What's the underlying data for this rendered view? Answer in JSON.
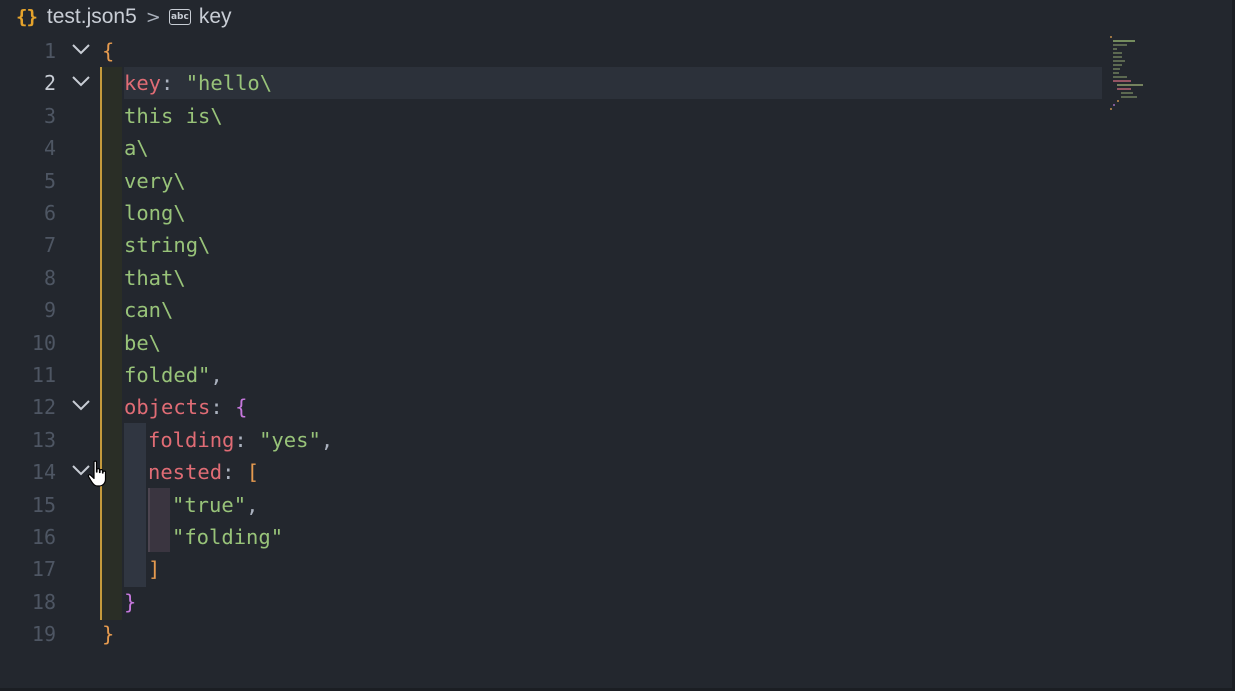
{
  "breadcrumb": {
    "file_icon": "{}",
    "file": "test.json5",
    "separator": ">",
    "symbol_icon": "abc",
    "symbol": "key"
  },
  "lines": [
    {
      "n": "1"
    },
    {
      "n": "2"
    },
    {
      "n": "3"
    },
    {
      "n": "4"
    },
    {
      "n": "5"
    },
    {
      "n": "6"
    },
    {
      "n": "7"
    },
    {
      "n": "8"
    },
    {
      "n": "9"
    },
    {
      "n": "10"
    },
    {
      "n": "11"
    },
    {
      "n": "12"
    },
    {
      "n": "13"
    },
    {
      "n": "14"
    },
    {
      "n": "15"
    },
    {
      "n": "16"
    },
    {
      "n": "17"
    },
    {
      "n": "18"
    },
    {
      "n": "19"
    }
  ],
  "code": {
    "l1_brace": "{",
    "l2_key": "key",
    "l2_colon": ": ",
    "l2_str": "\"hello\\",
    "l3": "this is\\",
    "l4": "a\\",
    "l5": "very\\",
    "l6": "long\\",
    "l7": "string\\",
    "l8": "that\\",
    "l9": "can\\",
    "l10": "be\\",
    "l11_str": "folded\"",
    "l11_comma": ",",
    "l12_key": "objects",
    "l12_colon": ": ",
    "l12_brace": "{",
    "l13_key": "folding",
    "l13_colon": ": ",
    "l13_str": "\"yes\"",
    "l13_comma": ",",
    "l14_key": "nested",
    "l14_colon": ": ",
    "l14_bracket": "[",
    "l15_str": "\"true\"",
    "l15_comma": ",",
    "l16_str": "\"folding\"",
    "l17_bracket": "]",
    "l18_brace": "}",
    "l19_brace": "}"
  },
  "colors": {
    "background": "#23272e",
    "key": "#e06c75",
    "string": "#98c379",
    "bracket_orange": "#e59a4f",
    "bracket_purple": "#c678dd",
    "json_icon": "#e5a32c"
  }
}
